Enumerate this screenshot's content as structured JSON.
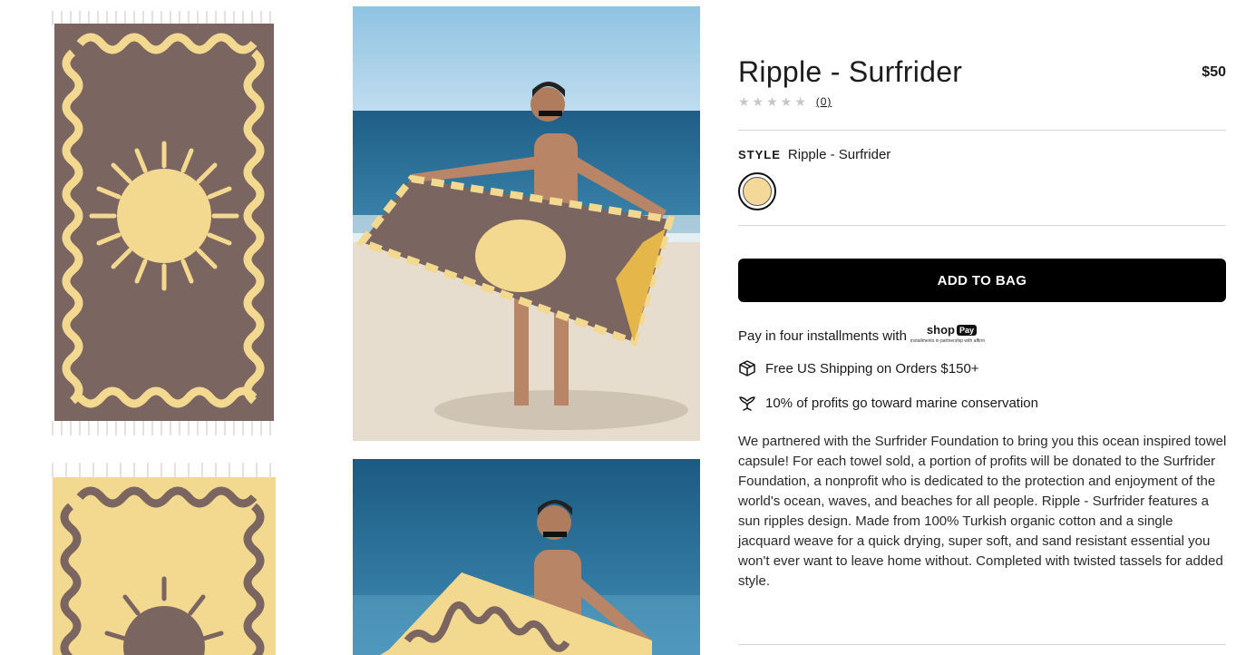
{
  "product": {
    "title": "Ripple - Surfrider",
    "price": "$50",
    "rating_stars": "★★★★★",
    "rating_count": "(0)",
    "style_label": "STYLE",
    "style_value": "Ripple - Surfrider",
    "swatch_color": "#F3D89A"
  },
  "actions": {
    "add_to_bag": "ADD TO BAG"
  },
  "payment": {
    "text": "Pay in four installments with",
    "shop_logo": "shop",
    "shop_pay": "Pay",
    "shop_sub": "installments in partnership with affirm"
  },
  "features": {
    "shipping": "Free US Shipping on Orders $150+",
    "conservation": "10% of profits go toward marine conservation"
  },
  "description": "We partnered with the Surfrider Foundation to bring you this ocean inspired towel capsule! For each towel sold, a portion of profits will be donated to the Surfrider Foundation, a nonprofit who is dedicated to the protection and enjoyment of the world's ocean, waves, and beaches for all people. Ripple - Surfrider features a sun ripples design. Made from 100% Turkish organic cotton and a single jacquard weave for a quick drying, super soft, and sand resistant essential you won't ever want to leave home without. Completed with twisted tassels for added style.",
  "colors": {
    "towel_brown": "#7B6560",
    "towel_yellow": "#F3D88F",
    "sky": "#A9CFE6",
    "ocean": "#2E6F94",
    "sand": "#E7DDCF"
  },
  "icons": {
    "shipping": "box-icon",
    "conservation": "whale-tail-icon"
  }
}
